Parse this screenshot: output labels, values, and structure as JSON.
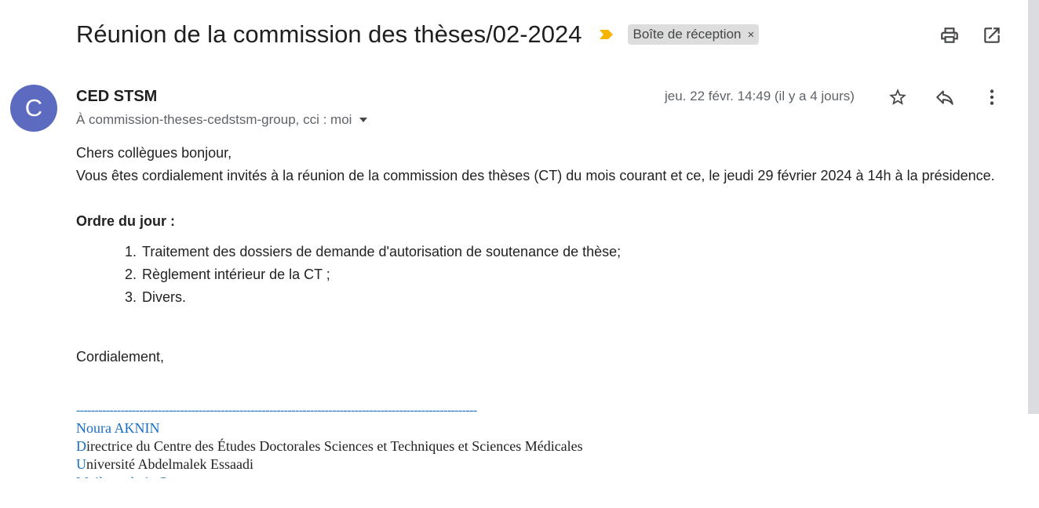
{
  "header": {
    "subject": "Réunion de la commission des thèses/02-2024",
    "label_chip": "Boîte de réception",
    "label_chip_close": "×",
    "icons": [
      "importance-marker-icon",
      "print-icon",
      "open-in-new-window-icon"
    ],
    "importance_color": "#f4b400"
  },
  "message": {
    "avatar_letter": "C",
    "avatar_color": "#5c6bc0",
    "sender": "CED STSM",
    "recipients": "À commission-theses-cedstsm-group, cci : moi",
    "date": "jeu. 22 févr. 14:49 (il y a 4 jours)",
    "action_icons": [
      "star-icon",
      "reply-icon",
      "more-vert-icon"
    ]
  },
  "body": {
    "greeting": "Chers collègues bonjour,",
    "paragraph": "Vous êtes cordialement invités à la réunion de la commission des thèses (CT) du mois courant et ce, le jeudi 29 février 2024 à 14h à la présidence.",
    "agenda_title": "Ordre du jour :",
    "agenda_items": [
      "Traitement des dossiers de demande d'autorisation de soutenance de thèse;",
      "Règlement intérieur de la CT ;",
      "Divers."
    ],
    "closing": "Cordialement,"
  },
  "signature": {
    "divider": "------------------------------------------------------------------------------------------------------------",
    "name": "Noura AKNIN",
    "line1_initial": "D",
    "line1_rest": "irectrice du Centre des Études Doctorales Sciences et Techniques et Sciences Médicales",
    "line2_initial": "U",
    "line2_rest": "niversité Abdelmalek Essaadi",
    "line3_partial": "Mail : n.aknin@"
  }
}
